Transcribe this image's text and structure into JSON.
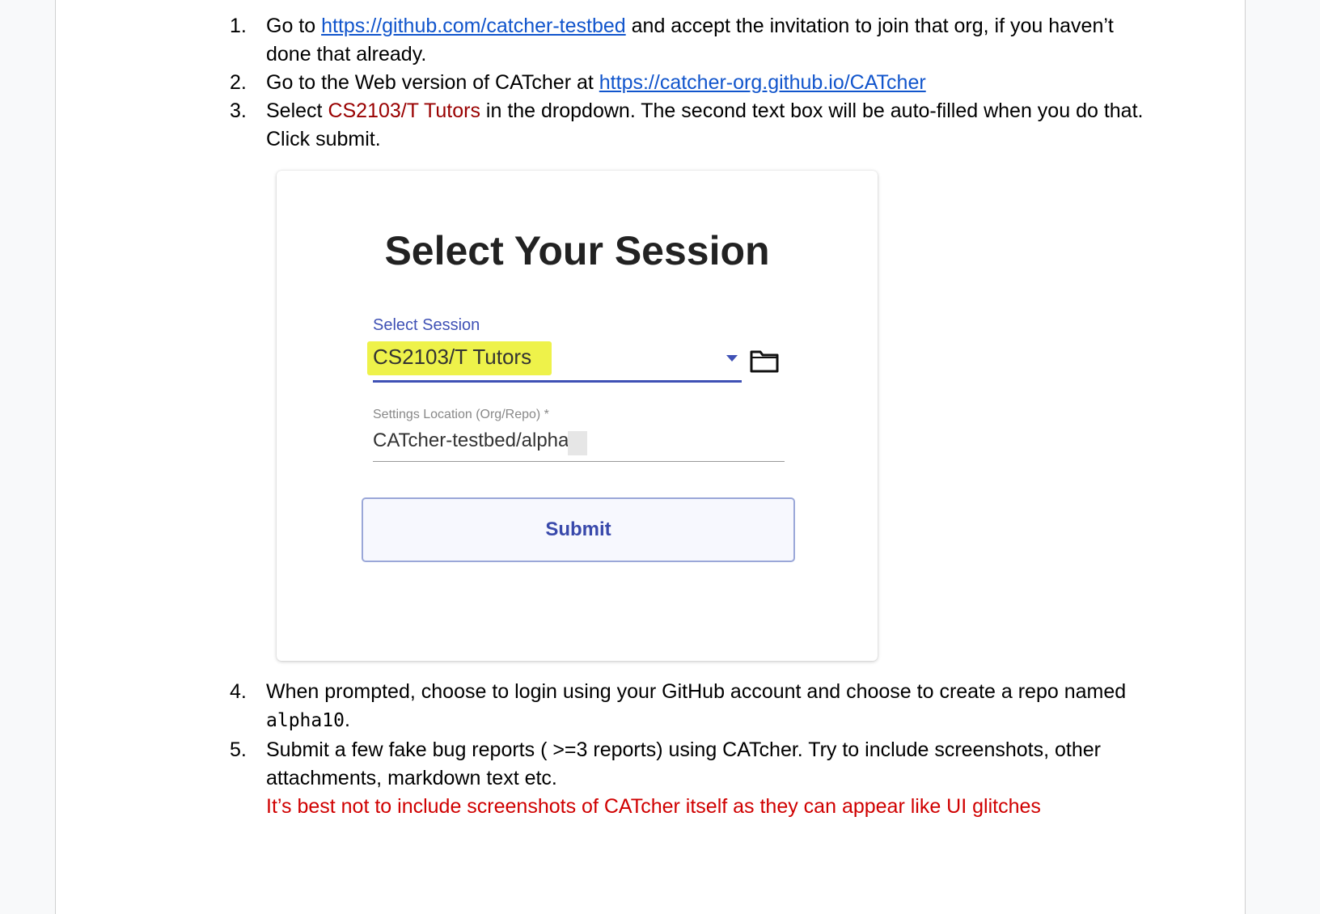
{
  "steps": [
    {
      "num": "1.",
      "pre": "Go to ",
      "link": "https://github.com/catcher-testbed",
      "post": " and accept the invitation to join that org, if you haven’t done that already."
    },
    {
      "num": "2.",
      "pre": "Go to the Web version of CATcher at ",
      "link": "https://catcher-org.github.io/CATcher",
      "post": ""
    },
    {
      "num": "3.",
      "pre": "Select ",
      "highlight": "CS2103/T Tutors",
      "post": " in the dropdown. The second text box will be auto-filled when you do that. Click submit."
    },
    {
      "num": "4.",
      "pre": "When prompted, choose to login using your GitHub account and choose to create a repo named ",
      "code": "alpha10",
      "post": "."
    },
    {
      "num": "5.",
      "pre": "Submit a few fake bug reports ( >=3 reports) using CATcher. Try to include screenshots, other attachments, markdown text etc.",
      "warning": "It’s best not to include screenshots of CATcher itself as they can appear like UI glitches"
    }
  ],
  "session_card": {
    "title": "Select Your Session",
    "select_label": "Select Session",
    "select_value": "CS2103/T Tutors",
    "settings_label": "Settings Location (Org/Repo) *",
    "settings_value": "CATcher-testbed/alpha",
    "submit_label": "Submit",
    "icons": [
      "dropdown-arrow-icon",
      "folder-icon"
    ],
    "accent_color": "#3f51b5",
    "highlight_color": "#eef24a"
  }
}
